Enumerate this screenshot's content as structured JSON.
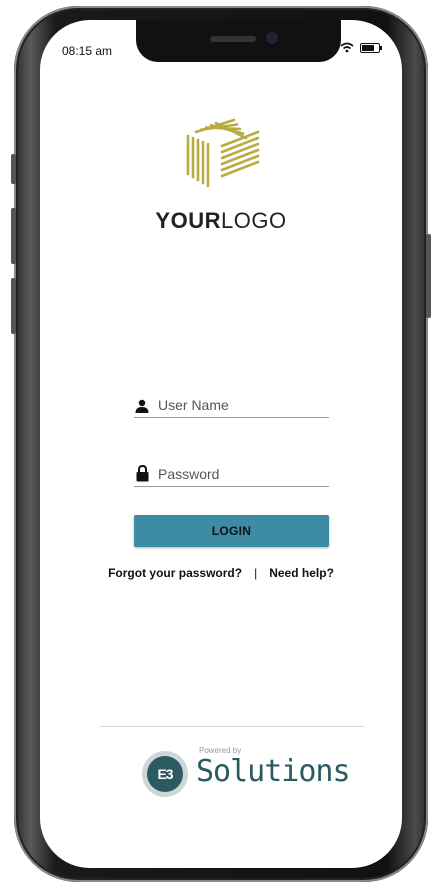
{
  "status_bar": {
    "time": "08:15 am"
  },
  "logo": {
    "text_bold": "YOUR",
    "text_thin": "LOGO"
  },
  "form": {
    "username_placeholder": "User Name",
    "password_placeholder": "Password",
    "login_label": "LOGIN"
  },
  "links": {
    "forgot_password": "Forgot your password?",
    "separator": "|",
    "need_help": "Need help?"
  },
  "footer": {
    "powered_by": "Powered by",
    "badge_text": "E3",
    "brand_name": "Solutions"
  },
  "colors": {
    "accent": "#3d8ca3",
    "logo_gold": "#b8ac3e",
    "brand": "#2c5a62"
  }
}
